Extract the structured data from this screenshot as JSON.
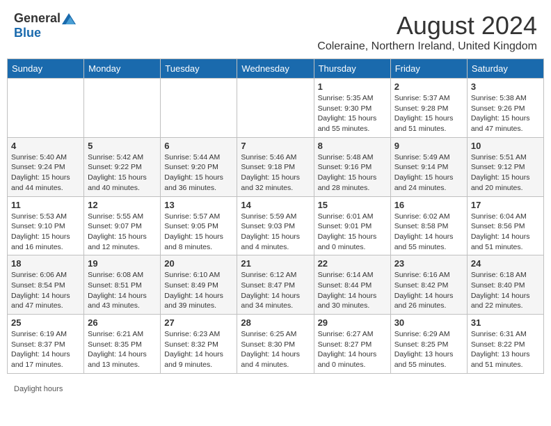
{
  "header": {
    "logo_general": "General",
    "logo_blue": "Blue",
    "month_title": "August 2024",
    "subtitle": "Coleraine, Northern Ireland, United Kingdom"
  },
  "calendar": {
    "days_of_week": [
      "Sunday",
      "Monday",
      "Tuesday",
      "Wednesday",
      "Thursday",
      "Friday",
      "Saturday"
    ],
    "weeks": [
      [
        {
          "day": "",
          "info": ""
        },
        {
          "day": "",
          "info": ""
        },
        {
          "day": "",
          "info": ""
        },
        {
          "day": "",
          "info": ""
        },
        {
          "day": "1",
          "info": "Sunrise: 5:35 AM\nSunset: 9:30 PM\nDaylight: 15 hours and 55 minutes."
        },
        {
          "day": "2",
          "info": "Sunrise: 5:37 AM\nSunset: 9:28 PM\nDaylight: 15 hours and 51 minutes."
        },
        {
          "day": "3",
          "info": "Sunrise: 5:38 AM\nSunset: 9:26 PM\nDaylight: 15 hours and 47 minutes."
        }
      ],
      [
        {
          "day": "4",
          "info": "Sunrise: 5:40 AM\nSunset: 9:24 PM\nDaylight: 15 hours and 44 minutes."
        },
        {
          "day": "5",
          "info": "Sunrise: 5:42 AM\nSunset: 9:22 PM\nDaylight: 15 hours and 40 minutes."
        },
        {
          "day": "6",
          "info": "Sunrise: 5:44 AM\nSunset: 9:20 PM\nDaylight: 15 hours and 36 minutes."
        },
        {
          "day": "7",
          "info": "Sunrise: 5:46 AM\nSunset: 9:18 PM\nDaylight: 15 hours and 32 minutes."
        },
        {
          "day": "8",
          "info": "Sunrise: 5:48 AM\nSunset: 9:16 PM\nDaylight: 15 hours and 28 minutes."
        },
        {
          "day": "9",
          "info": "Sunrise: 5:49 AM\nSunset: 9:14 PM\nDaylight: 15 hours and 24 minutes."
        },
        {
          "day": "10",
          "info": "Sunrise: 5:51 AM\nSunset: 9:12 PM\nDaylight: 15 hours and 20 minutes."
        }
      ],
      [
        {
          "day": "11",
          "info": "Sunrise: 5:53 AM\nSunset: 9:10 PM\nDaylight: 15 hours and 16 minutes."
        },
        {
          "day": "12",
          "info": "Sunrise: 5:55 AM\nSunset: 9:07 PM\nDaylight: 15 hours and 12 minutes."
        },
        {
          "day": "13",
          "info": "Sunrise: 5:57 AM\nSunset: 9:05 PM\nDaylight: 15 hours and 8 minutes."
        },
        {
          "day": "14",
          "info": "Sunrise: 5:59 AM\nSunset: 9:03 PM\nDaylight: 15 hours and 4 minutes."
        },
        {
          "day": "15",
          "info": "Sunrise: 6:01 AM\nSunset: 9:01 PM\nDaylight: 15 hours and 0 minutes."
        },
        {
          "day": "16",
          "info": "Sunrise: 6:02 AM\nSunset: 8:58 PM\nDaylight: 14 hours and 55 minutes."
        },
        {
          "day": "17",
          "info": "Sunrise: 6:04 AM\nSunset: 8:56 PM\nDaylight: 14 hours and 51 minutes."
        }
      ],
      [
        {
          "day": "18",
          "info": "Sunrise: 6:06 AM\nSunset: 8:54 PM\nDaylight: 14 hours and 47 minutes."
        },
        {
          "day": "19",
          "info": "Sunrise: 6:08 AM\nSunset: 8:51 PM\nDaylight: 14 hours and 43 minutes."
        },
        {
          "day": "20",
          "info": "Sunrise: 6:10 AM\nSunset: 8:49 PM\nDaylight: 14 hours and 39 minutes."
        },
        {
          "day": "21",
          "info": "Sunrise: 6:12 AM\nSunset: 8:47 PM\nDaylight: 14 hours and 34 minutes."
        },
        {
          "day": "22",
          "info": "Sunrise: 6:14 AM\nSunset: 8:44 PM\nDaylight: 14 hours and 30 minutes."
        },
        {
          "day": "23",
          "info": "Sunrise: 6:16 AM\nSunset: 8:42 PM\nDaylight: 14 hours and 26 minutes."
        },
        {
          "day": "24",
          "info": "Sunrise: 6:18 AM\nSunset: 8:40 PM\nDaylight: 14 hours and 22 minutes."
        }
      ],
      [
        {
          "day": "25",
          "info": "Sunrise: 6:19 AM\nSunset: 8:37 PM\nDaylight: 14 hours and 17 minutes."
        },
        {
          "day": "26",
          "info": "Sunrise: 6:21 AM\nSunset: 8:35 PM\nDaylight: 14 hours and 13 minutes."
        },
        {
          "day": "27",
          "info": "Sunrise: 6:23 AM\nSunset: 8:32 PM\nDaylight: 14 hours and 9 minutes."
        },
        {
          "day": "28",
          "info": "Sunrise: 6:25 AM\nSunset: 8:30 PM\nDaylight: 14 hours and 4 minutes."
        },
        {
          "day": "29",
          "info": "Sunrise: 6:27 AM\nSunset: 8:27 PM\nDaylight: 14 hours and 0 minutes."
        },
        {
          "day": "30",
          "info": "Sunrise: 6:29 AM\nSunset: 8:25 PM\nDaylight: 13 hours and 55 minutes."
        },
        {
          "day": "31",
          "info": "Sunrise: 6:31 AM\nSunset: 8:22 PM\nDaylight: 13 hours and 51 minutes."
        }
      ]
    ]
  },
  "footer": {
    "text": "Daylight hours"
  }
}
